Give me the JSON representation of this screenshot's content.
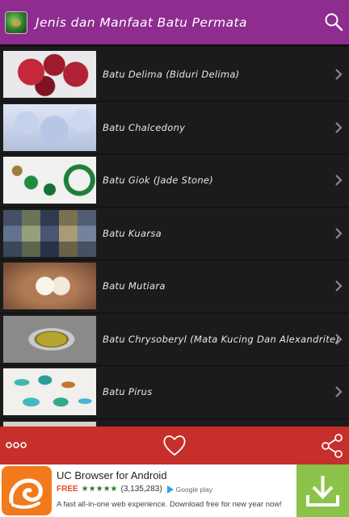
{
  "app": {
    "title": "Jenis dan Manfaat Batu Permata",
    "icon": "app-gem-icon",
    "search_icon": "search-icon",
    "bar_color": "#8e2c8f"
  },
  "list": {
    "items": [
      {
        "label": "Batu Delima (Biduri Delima)",
        "thumb": "red-garnet-gems"
      },
      {
        "label": "Batu Chalcedony",
        "thumb": "blue-chalcedony-gems"
      },
      {
        "label": "Batu Giok (Jade Stone)",
        "thumb": "green-jade-jewelry"
      },
      {
        "label": "Batu Kuarsa",
        "thumb": "quartz-collage"
      },
      {
        "label": "Batu Mutiara",
        "thumb": "pearls-in-hand"
      },
      {
        "label": "Batu Chrysoberyl (Mata Kucing Dan Alexandrite)",
        "thumb": "cats-eye-ring"
      },
      {
        "label": "Batu Pirus",
        "thumb": "turquoise-stones"
      }
    ],
    "chevron_icon": "chevron-right-icon"
  },
  "actionbar": {
    "color": "#c62f2b",
    "more_icon": "more-dots-icon",
    "like_icon": "heart-icon",
    "share_icon": "share-icon"
  },
  "ad": {
    "app_name": "UC Browser for Android",
    "free_label": "FREE",
    "stars": "★★★★★",
    "rating_count": "(3,135,283)",
    "store_label": "Google play",
    "description": "A fast all-in-one web experience. Download free for new year now!",
    "download_icon": "download-icon",
    "logo_icon": "uc-squirrel-logo",
    "accent": "#8bc34a"
  }
}
